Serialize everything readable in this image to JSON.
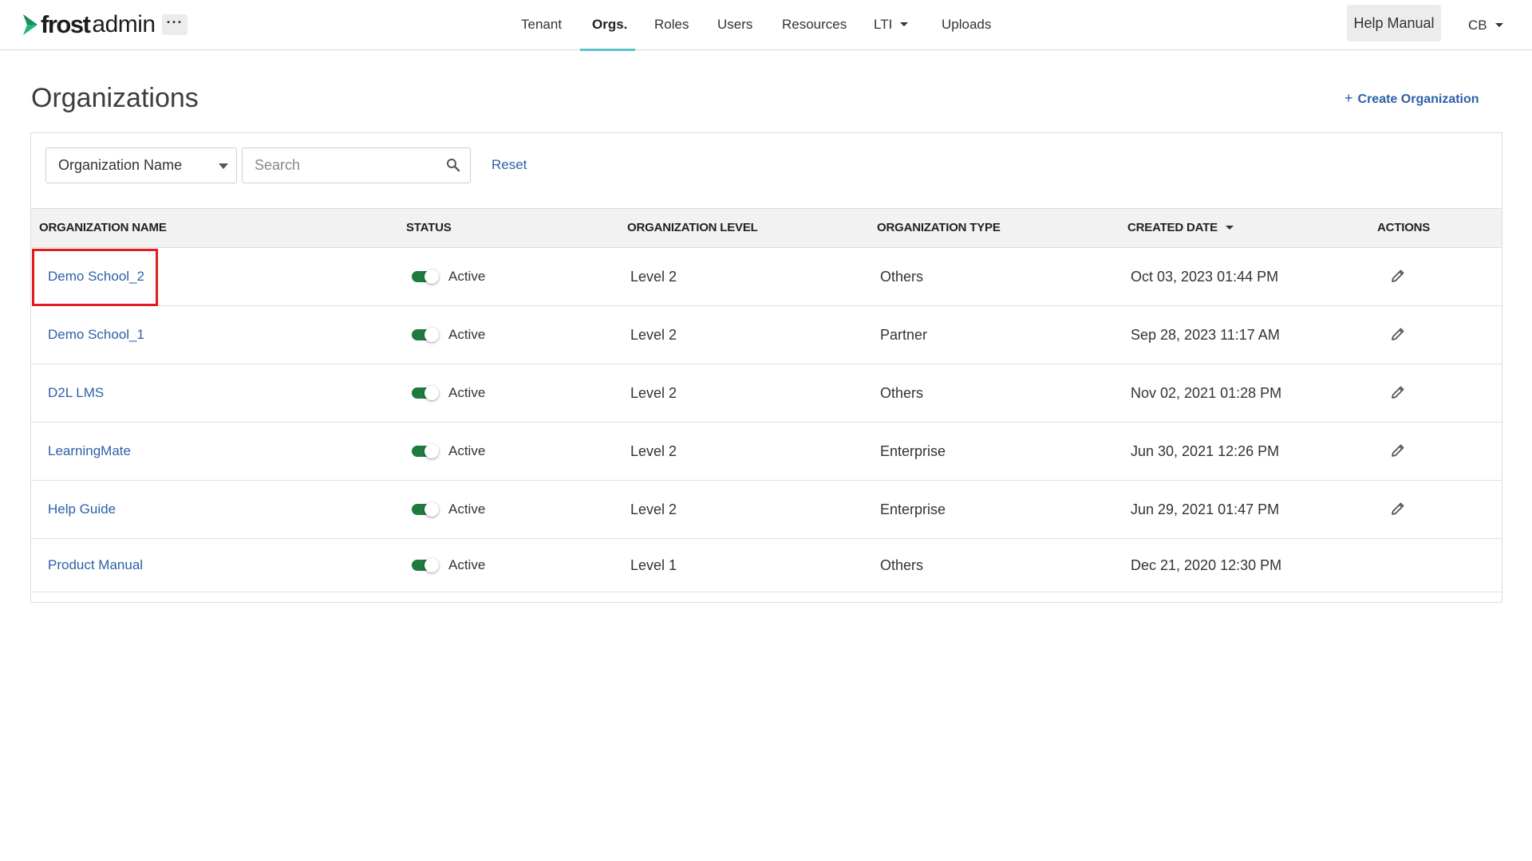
{
  "header": {
    "logo_brand": "frost",
    "logo_suffix": "admin",
    "more_label": "···",
    "nav": [
      {
        "label": "Tenant"
      },
      {
        "label": "Orgs."
      },
      {
        "label": "Roles"
      },
      {
        "label": "Users"
      },
      {
        "label": "Resources"
      },
      {
        "label": "LTI"
      },
      {
        "label": "Uploads"
      }
    ],
    "active_nav": "Orgs.",
    "help_label": "Help Manual",
    "user_initials": "CB"
  },
  "page": {
    "title": "Organizations",
    "create_label": "Create Organization"
  },
  "filter": {
    "field_value": "Organization Name",
    "search_placeholder": "Search",
    "reset_label": "Reset"
  },
  "table": {
    "columns": [
      "ORGANIZATION NAME",
      "STATUS",
      "ORGANIZATION LEVEL",
      "ORGANIZATION TYPE",
      "CREATED DATE",
      "ACTIONS"
    ],
    "sorted_column": "CREATED DATE",
    "rows": [
      {
        "name": "Demo School_2",
        "status": "Active",
        "level": "Level 2",
        "type": "Others",
        "created": "Oct 03, 2023 01:44 PM",
        "editable": true
      },
      {
        "name": "Demo School_1",
        "status": "Active",
        "level": "Level 2",
        "type": "Partner",
        "created": "Sep 28, 2023 11:17 AM",
        "editable": true
      },
      {
        "name": "D2L LMS",
        "status": "Active",
        "level": "Level 2",
        "type": "Others",
        "created": "Nov 02, 2021 01:28 PM",
        "editable": true
      },
      {
        "name": "LearningMate",
        "status": "Active",
        "level": "Level 2",
        "type": "Enterprise",
        "created": "Jun 30, 2021 12:26 PM",
        "editable": true
      },
      {
        "name": "Help Guide",
        "status": "Active",
        "level": "Level 2",
        "type": "Enterprise",
        "created": "Jun 29, 2021 01:47 PM",
        "editable": true
      },
      {
        "name": "Product Manual",
        "status": "Active",
        "level": "Level 1",
        "type": "Others",
        "created": "Dec 21, 2020 12:30 PM",
        "editable": false
      }
    ]
  },
  "colors": {
    "accent": "#5ec3c9",
    "link": "#2d5fa8",
    "toggle_on": "#1f7a3f",
    "highlight": "#e31b1b"
  },
  "icons": {
    "logo": "chevron-logo-icon",
    "search": "search-icon",
    "edit": "pencil-icon",
    "caret": "caret-down-icon",
    "add": "plus-icon"
  }
}
